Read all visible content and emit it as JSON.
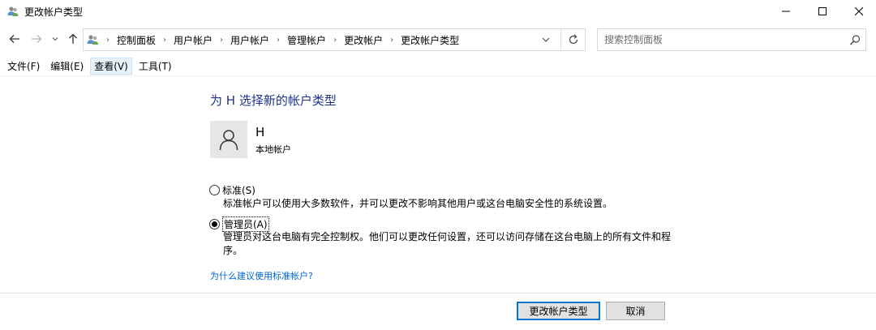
{
  "window": {
    "title": "更改帐户类型"
  },
  "nav": {
    "breadcrumbs": [
      "控制面板",
      "用户帐户",
      "用户帐户",
      "管理帐户",
      "更改帐户",
      "更改帐户类型"
    ],
    "search_placeholder": "搜索控制面板"
  },
  "menu": {
    "file": "文件(F)",
    "edit": "编辑(E)",
    "view": "查看(V)",
    "tools": "工具(T)"
  },
  "main": {
    "title": "为 H 选择新的帐户类型",
    "user": {
      "name": "H",
      "type": "本地帐户"
    },
    "options": [
      {
        "label": "标准(S)",
        "selected": false,
        "description": "标准帐户可以使用大多数软件，并可以更改不影响其他用户或这台电脑安全性的系统设置。"
      },
      {
        "label": "管理员(A)",
        "selected": true,
        "description_line1": "管理员对这台电脑有完全控制权。他们可以更改任何设置，还可以访问存储在这台电脑上的所有文件和程",
        "description_line2": "序。"
      }
    ],
    "why_link": "为什么建议使用标准帐户?"
  },
  "buttons": {
    "change": "更改帐户类型",
    "cancel": "取消"
  }
}
